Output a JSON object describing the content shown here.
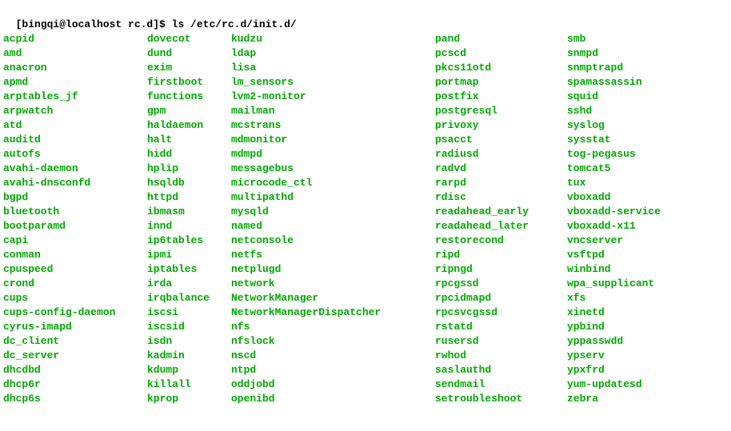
{
  "prompt": {
    "text": "[bingqi@localhost rc.d]$ ",
    "command": "ls /etc/rc.d/init.d/"
  },
  "columns": [
    [
      "acpid",
      "amd",
      "anacron",
      "apmd",
      "arptables_jf",
      "arpwatch",
      "atd",
      "auditd",
      "autofs",
      "avahi-daemon",
      "avahi-dnsconfd",
      "bgpd",
      "bluetooth",
      "bootparamd",
      "capi",
      "conman",
      "cpuspeed",
      "crond",
      "cups",
      "cups-config-daemon",
      "cyrus-imapd",
      "dc_client",
      "dc_server",
      "dhcdbd",
      "dhcp6r",
      "dhcp6s"
    ],
    [
      "dovecot",
      "dund",
      "exim",
      "firstboot",
      "functions",
      "gpm",
      "haldaemon",
      "halt",
      "hidd",
      "hplip",
      "hsqldb",
      "httpd",
      "ibmasm",
      "innd",
      "ip6tables",
      "ipmi",
      "iptables",
      "irda",
      "irqbalance",
      "iscsi",
      "iscsid",
      "isdn",
      "kadmin",
      "kdump",
      "killall",
      "kprop"
    ],
    [
      "kudzu",
      "ldap",
      "lisa",
      "lm_sensors",
      "lvm2-monitor",
      "mailman",
      "mcstrans",
      "mdmonitor",
      "mdmpd",
      "messagebus",
      "microcode_ctl",
      "multipathd",
      "mysqld",
      "named",
      "netconsole",
      "netfs",
      "netplugd",
      "network",
      "NetworkManager",
      "NetworkManagerDispatcher",
      "nfs",
      "nfslock",
      "nscd",
      "ntpd",
      "oddjobd",
      "openibd"
    ],
    [
      "pand",
      "pcscd",
      "pkcs11otd",
      "portmap",
      "postfix",
      "postgresql",
      "privoxy",
      "psacct",
      "radiusd",
      "radvd",
      "rarpd",
      "rdisc",
      "readahead_early",
      "readahead_later",
      "restorecond",
      "ripd",
      "ripngd",
      "rpcgssd",
      "rpcidmapd",
      "rpcsvcgssd",
      "rstatd",
      "rusersd",
      "rwhod",
      "saslauthd",
      "sendmail",
      "setroubleshoot"
    ],
    [
      "smb",
      "snmpd",
      "snmptrapd",
      "spamassassin",
      "squid",
      "sshd",
      "syslog",
      "sysstat",
      "tog-pegasus",
      "tomcat5",
      "tux",
      "vboxadd",
      "vboxadd-service",
      "vboxadd-x11",
      "vncserver",
      "vsftpd",
      "winbind",
      "wpa_supplicant",
      "xfs",
      "xinetd",
      "ypbind",
      "yppasswdd",
      "ypserv",
      "ypxfrd",
      "yum-updatesd",
      "zebra"
    ]
  ]
}
